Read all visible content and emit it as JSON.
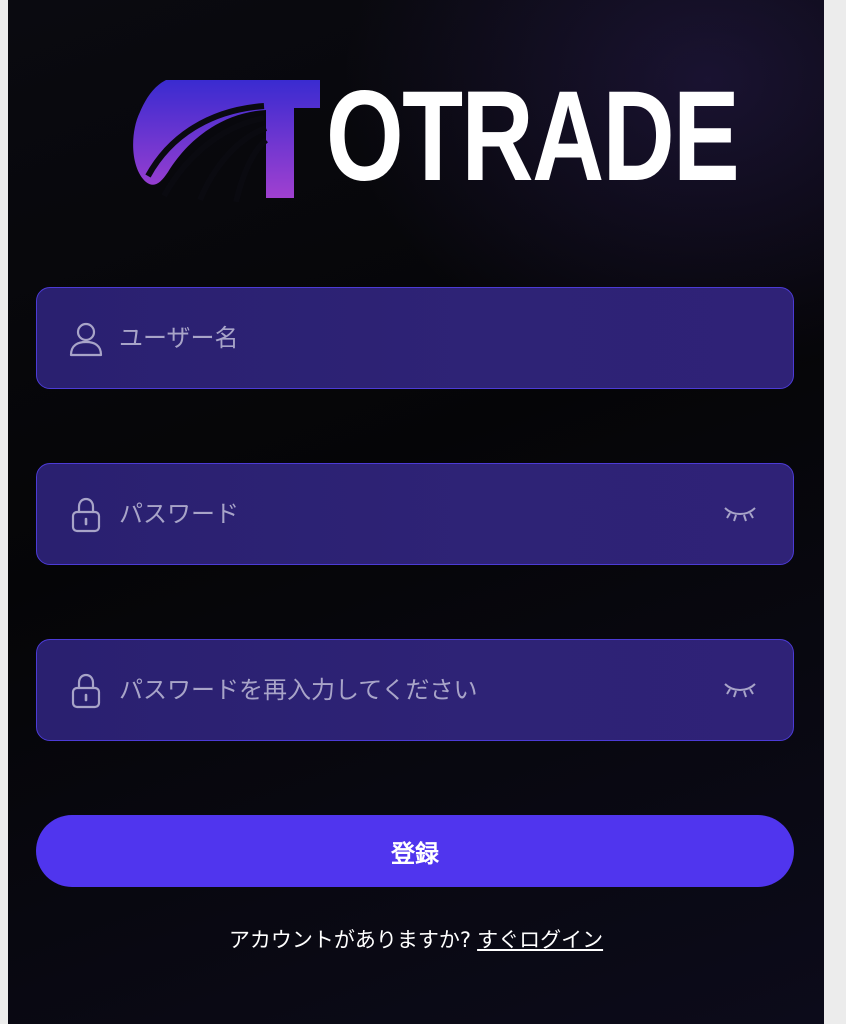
{
  "brand": {
    "logo_text": "OTRADE",
    "colors": {
      "mark_top": "#3a2bd0",
      "mark_bottom": "#a040d0"
    }
  },
  "form": {
    "username": {
      "placeholder": "ユーザー名",
      "value": "",
      "icon": "user-icon"
    },
    "password": {
      "placeholder": "パスワード",
      "value": "",
      "icon": "lock-icon",
      "toggle_icon": "eye-closed-icon"
    },
    "confirm_password": {
      "placeholder": "パスワードを再入力してください",
      "value": "",
      "icon": "lock-icon",
      "toggle_icon": "eye-closed-icon"
    },
    "submit_label": "登録"
  },
  "footer": {
    "prompt": "アカウントがありますか?",
    "login_link": "すぐログイン"
  },
  "colors": {
    "accent": "#5035ee",
    "field_bg": "#2b2072",
    "field_border": "#4c3bd6",
    "background": "#050507"
  }
}
